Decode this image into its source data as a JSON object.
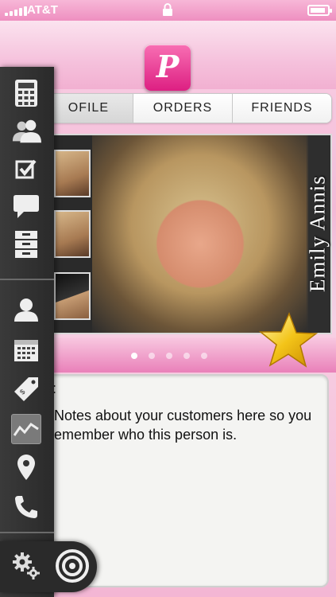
{
  "status_bar": {
    "carrier": "AT&T"
  },
  "tabs": [
    {
      "label": "OFILE",
      "active": true
    },
    {
      "label": "ORDERS",
      "active": false
    },
    {
      "label": "FRIENDS",
      "active": false
    }
  ],
  "profile": {
    "name": "Emily Annis"
  },
  "pager": {
    "count": 5,
    "active_index": 0
  },
  "notes": {
    "label": ":",
    "text": "Notes about your customers here so you emember who this person is."
  },
  "sidebar_icons": [
    "calculator-icon",
    "contacts-icon",
    "checklist-icon",
    "chat-icon",
    "cabinet-icon",
    "person-icon",
    "calendar-icon",
    "price-tag-icon",
    "chart-icon",
    "location-pin-icon",
    "phone-icon",
    "settings-icon",
    "target-icon"
  ],
  "colors": {
    "accent": "#e8338f",
    "sidebar": "#2f2f2f"
  }
}
